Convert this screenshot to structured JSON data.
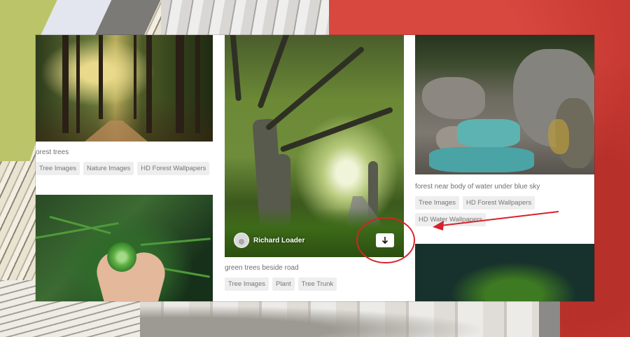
{
  "col1": {
    "photo1": {
      "caption": "orest trees",
      "tags": [
        "Tree Images",
        "Nature Images",
        "HD Forest Wallpapers"
      ]
    }
  },
  "col2": {
    "photo": {
      "author": "Richard Loader",
      "caption": "green trees beside road",
      "tags": [
        "Tree Images",
        "Plant",
        "Tree Trunk"
      ]
    }
  },
  "col3": {
    "photo": {
      "caption": "forest near body of water under blue sky",
      "tags": [
        "Tree Images",
        "HD Forest Wallpapers",
        "HD Water Wallpapers"
      ]
    }
  },
  "icons": {
    "download": "download-arrow-icon",
    "avatar": "user-avatar-icon"
  },
  "colors": {
    "annotation": "#d8212a",
    "tag_bg": "#eeeeee",
    "tag_text": "#767676"
  }
}
